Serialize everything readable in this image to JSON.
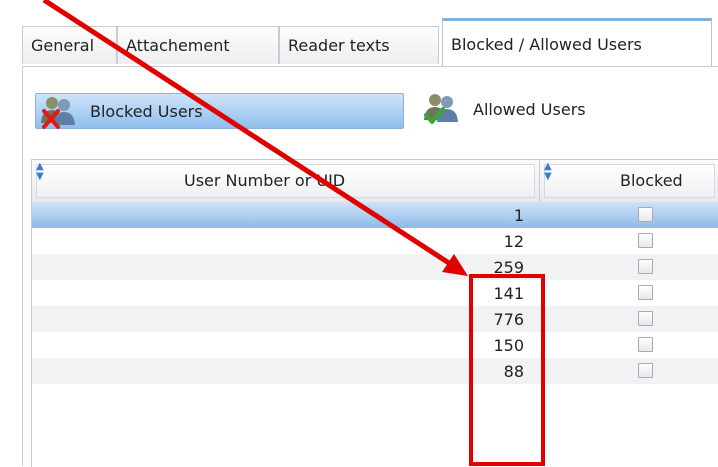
{
  "tabs": [
    {
      "label": "General"
    },
    {
      "label": "Attachement"
    },
    {
      "label": "Reader texts"
    },
    {
      "label": "Blocked / Allowed Users",
      "active": true
    }
  ],
  "buttons": {
    "blocked": "Blocked Users",
    "allowed": "Allowed Users"
  },
  "grid": {
    "columns": [
      "User Number or UID",
      "Blocked"
    ],
    "rows": [
      {
        "number": "1",
        "blocked": false,
        "selected": true
      },
      {
        "number": "12",
        "blocked": false
      },
      {
        "number": "259",
        "blocked": false
      },
      {
        "number": "141",
        "blocked": false
      },
      {
        "number": "776",
        "blocked": false
      },
      {
        "number": "150",
        "blocked": false
      },
      {
        "number": "88",
        "blocked": false
      }
    ]
  },
  "colors": {
    "annotation": "#e00000",
    "selection": "#8dbbe9",
    "tab_accent": "#7fb1dd"
  },
  "annotation": {
    "shape": "arrow-and-box",
    "target": "user-number-cells"
  }
}
